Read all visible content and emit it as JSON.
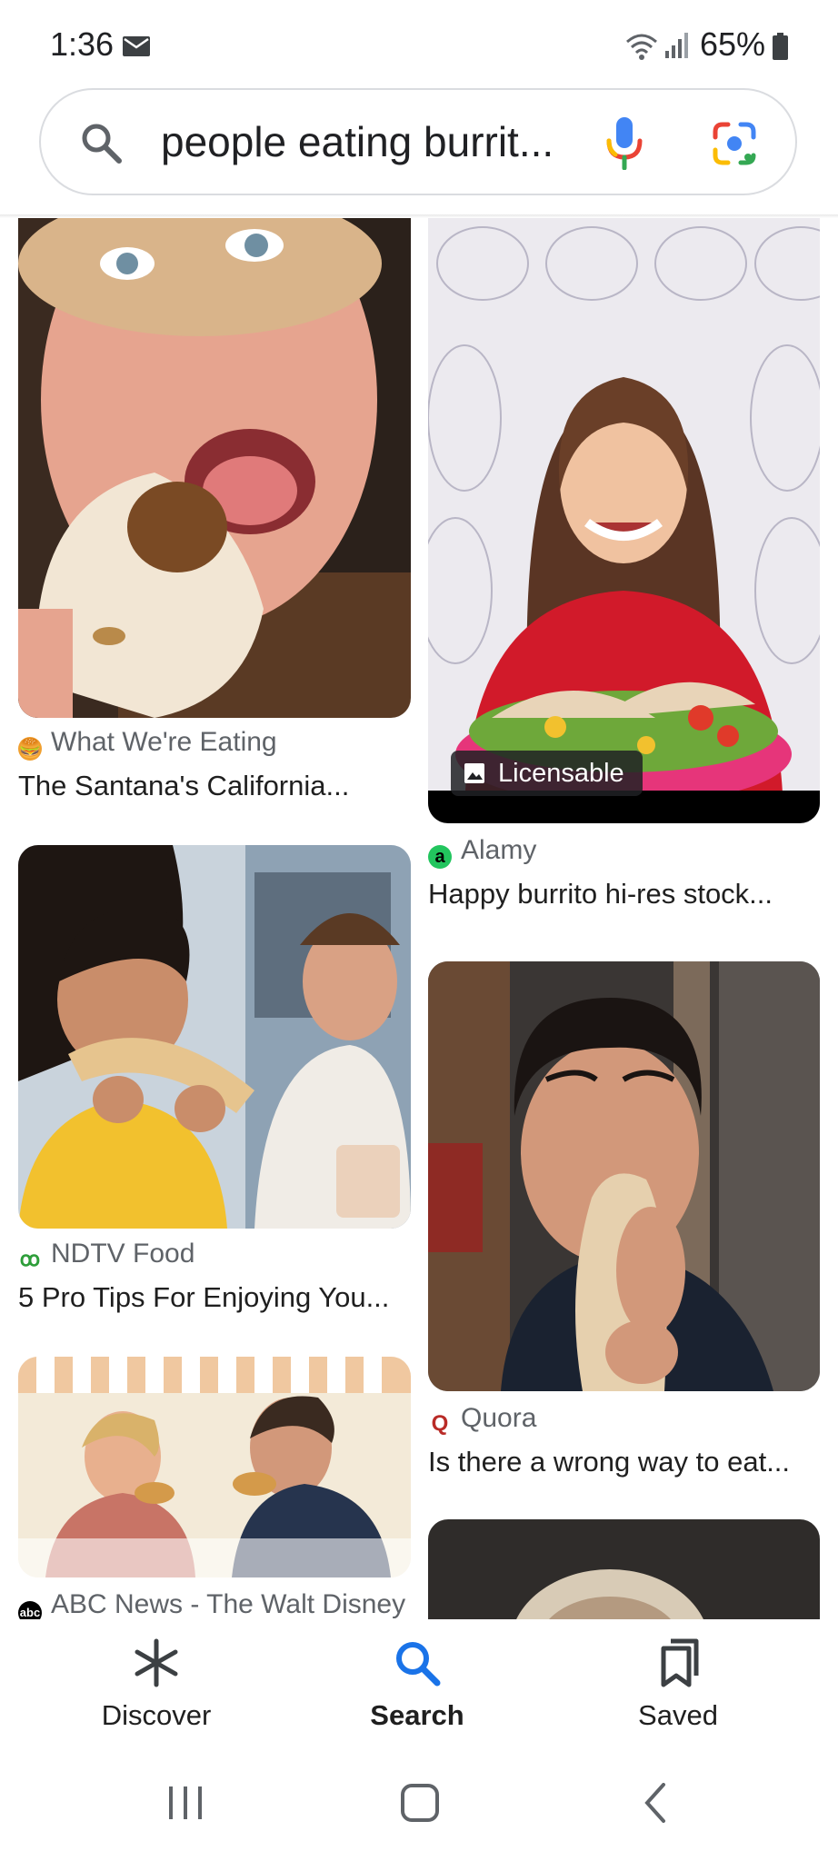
{
  "status_bar": {
    "time": "1:36",
    "battery": "65%"
  },
  "search": {
    "query": "people eating burrit..."
  },
  "results": [
    {
      "source": "What We're Eating",
      "title": "The Santana's California..."
    },
    {
      "source": "Alamy",
      "title": "Happy burrito hi-res stock...",
      "badge": "Licensable"
    },
    {
      "source": "NDTV Food",
      "title": "5 Pro Tips For Enjoying You..."
    },
    {
      "source": "Quora",
      "title": "Is there a wrong way to eat..."
    },
    {
      "source": "ABC News - The Walt Disney"
    }
  ],
  "bottom_nav": {
    "discover": "Discover",
    "search": "Search",
    "saved": "Saved"
  },
  "colors": {
    "accent": "#1a73e8",
    "text": "#1f1f1f",
    "secondary": "#5f6368"
  }
}
